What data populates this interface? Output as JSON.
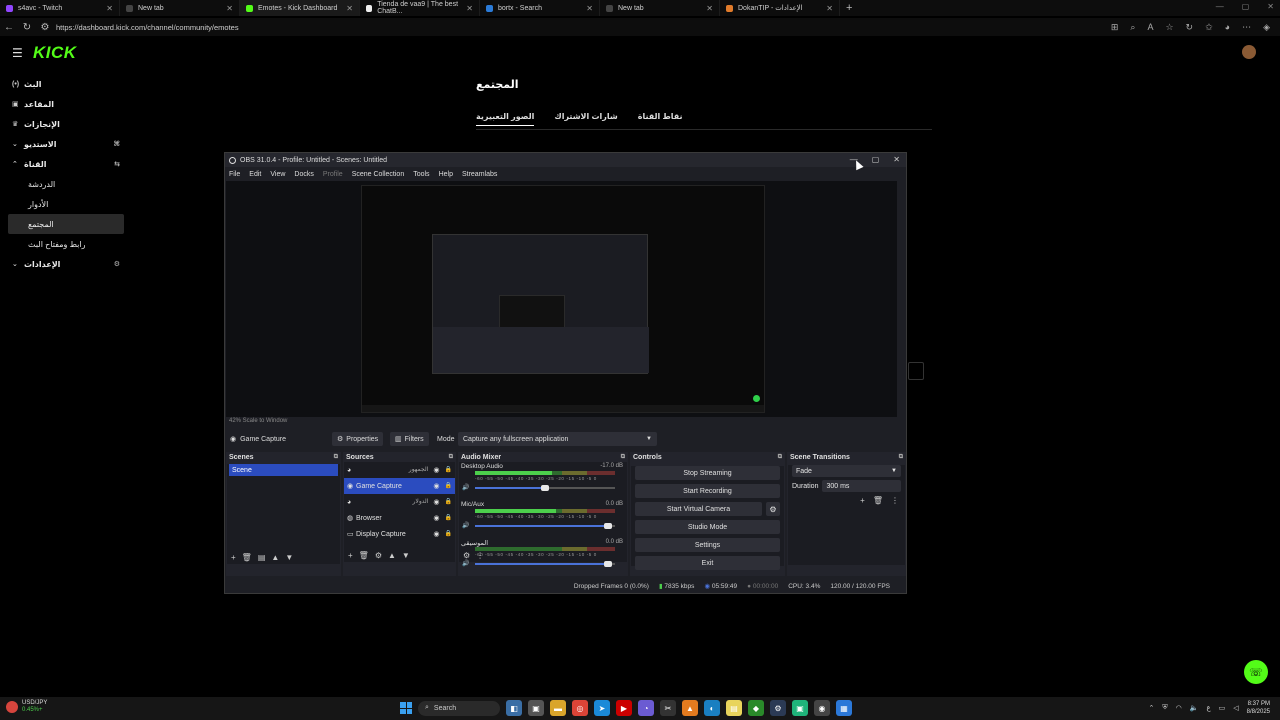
{
  "browser": {
    "tabs": [
      {
        "label": "s4avc - Twitch",
        "color": "#9146ff",
        "active": false
      },
      {
        "label": "New tab",
        "color": "#444",
        "active": false
      },
      {
        "label": "Emotes - Kick Dashboard",
        "color": "#53fc18",
        "active": true
      },
      {
        "label": "Tienda de vaa9 | The best ChatB...",
        "color": "#eeeeee",
        "active": false
      },
      {
        "label": "bortx - Search",
        "color": "#2b7bd8",
        "active": false
      },
      {
        "label": "New tab",
        "color": "#444",
        "active": false
      },
      {
        "label": "DokanTIP - الإعدادات",
        "color": "#e07b2b",
        "active": false
      }
    ],
    "url": "https://dashboard.kick.com/channel/community/emotes"
  },
  "kick": {
    "logo": "KICK",
    "sidebar": [
      {
        "label": "البث",
        "icon": "(•)",
        "sub": false,
        "active": false
      },
      {
        "label": "المقاعد",
        "icon": "▣",
        "sub": false,
        "active": false
      },
      {
        "label": "الإنجازات",
        "icon": "♛",
        "sub": false,
        "active": false
      },
      {
        "label": "الاستديو",
        "icon": "⌄",
        "sub": false,
        "active": false,
        "right": "⌘"
      },
      {
        "label": "القناة",
        "icon": "⌃",
        "sub": false,
        "active": false,
        "right": "⇆"
      },
      {
        "label": "الدردشة",
        "icon": "",
        "sub": true,
        "active": false
      },
      {
        "label": "الأدوار",
        "icon": "",
        "sub": true,
        "active": false
      },
      {
        "label": "المجتمع",
        "icon": "",
        "sub": true,
        "active": true
      },
      {
        "label": "رابط ومفتاح البث",
        "icon": "",
        "sub": true,
        "active": false
      },
      {
        "label": "الإعدادات",
        "icon": "⌄",
        "sub": false,
        "active": false,
        "right": "⚙"
      }
    ],
    "page_title": "المجتمع",
    "tabs": [
      "الصور التعبيرية",
      "شارات الاشتراك",
      "نقاط القناة"
    ]
  },
  "obs": {
    "title": "OBS 31.0.4 - Profile: Untitled - Scenes: Untitled",
    "menu": [
      "File",
      "Edit",
      "View",
      "Docks",
      "Profile",
      "Scene Collection",
      "Tools",
      "Help",
      "Streamlabs"
    ],
    "zoom_label": "42%   Scale to Window",
    "context": {
      "source": "Game Capture",
      "properties": "Properties",
      "filters": "Filters",
      "mode_label": "Mode",
      "mode_value": "Capture any fullscreen application"
    },
    "scenes": {
      "title": "Scenes",
      "items": [
        "Scene"
      ]
    },
    "sources": {
      "title": "Sources",
      "items": [
        {
          "label": "",
          "icon": "◕",
          "right": "الجمهور",
          "selected": false
        },
        {
          "label": "Game Capture",
          "icon": "◉",
          "right": "",
          "selected": true
        },
        {
          "label": "",
          "icon": "◕",
          "right": "الدولار",
          "selected": false
        },
        {
          "label": "Browser",
          "icon": "◍",
          "right": "",
          "selected": false
        },
        {
          "label": "Display Capture",
          "icon": "▭",
          "right": "",
          "selected": false
        }
      ]
    },
    "mixer": {
      "title": "Audio Mixer",
      "scale": "-60 -55 -50 -45 -40 -35 -30 -25 -20 -15 -10 -5 0",
      "channels": [
        {
          "name": "Desktop Audio",
          "db": "-17.0 dB",
          "level": 0.55,
          "volume": 0.5
        },
        {
          "name": "Mic/Aux",
          "db": "0.0 dB",
          "level": 0.58,
          "volume": 0.95
        },
        {
          "name": "الموسيقى",
          "db": "0.0 dB",
          "level": 0,
          "volume": 0.95
        }
      ]
    },
    "controls": {
      "title": "Controls",
      "stop_streaming": "Stop Streaming",
      "start_recording": "Start Recording",
      "start_virtual_camera": "Start Virtual Camera",
      "studio_mode": "Studio Mode",
      "settings": "Settings",
      "exit": "Exit"
    },
    "transitions": {
      "title": "Scene Transitions",
      "value": "Fade",
      "duration_label": "Duration",
      "duration_value": "300 ms"
    },
    "status": {
      "dropped": "Dropped Frames 0 (0.0%)",
      "kbps": "7835 kbps",
      "stream_time": "05:59:49",
      "rec_time": "00:00:00",
      "cpu": "CPU: 3.4%",
      "fps": "120.00 / 120.00 FPS"
    }
  },
  "taskbar": {
    "ticker_name": "USD/JPY",
    "ticker_value": "0.45%+",
    "search": "Search",
    "time": "8:37 PM",
    "date": "8/8/2025",
    "lang": "ع"
  }
}
